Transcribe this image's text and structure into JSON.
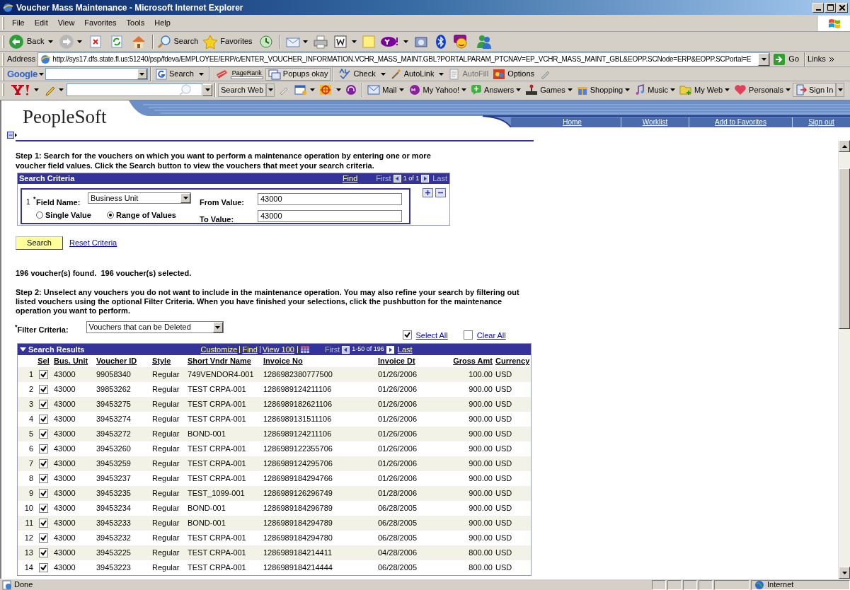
{
  "window": {
    "title": "Voucher Mass Maintenance - Microsoft Internet Explorer"
  },
  "menu": [
    "File",
    "Edit",
    "View",
    "Favorites",
    "Tools",
    "Help"
  ],
  "toolbar": {
    "back": "Back",
    "search": "Search",
    "favorites": "Favorites"
  },
  "address_bar": {
    "label": "Address",
    "url": "http://sys17.dfs.state.fl.us:51240/psp/fdeva/EMPLOYEE/ERP/c/ENTER_VOUCHER_INFORMATION.VCHR_MASS_MAINT.GBL?PORTALPARAM_PTCNAV=EP_VCHR_MASS_MAINT_GBL&EOPP.SCNode=ERP&EOPP.SCPortal=E",
    "go": "Go",
    "links": "Links"
  },
  "google_toolbar": {
    "logo": "Google",
    "pagerank": "PageRank",
    "items": [
      {
        "label": "Search",
        "disabled": false
      },
      {
        "label": "Popups okay",
        "disabled": false
      },
      {
        "label": "Check",
        "disabled": false
      },
      {
        "label": "AutoLink",
        "disabled": false
      },
      {
        "label": "AutoFill",
        "disabled": true
      },
      {
        "label": "Options",
        "disabled": false
      }
    ]
  },
  "yahoo_toolbar": {
    "search": "Search Web",
    "items": [
      "Mail",
      "My Yahoo!",
      "Answers",
      "Games",
      "Shopping",
      "Music",
      "My Web",
      "Personals"
    ],
    "sign_in": "Sign In"
  },
  "header": {
    "logo": "PeopleSoft",
    "nav": [
      "Home",
      "Worklist",
      "Add to Favorites",
      "Sign out"
    ]
  },
  "step1": "Step 1: Search for the vouchers on which you want to perform a maintenance operation by entering one or more voucher field values. Click the Search button to view the vouchers that meet your search criteria.",
  "search_criteria": {
    "title": "Search Criteria",
    "find": "Find",
    "first": "First",
    "count": "1 of 1",
    "last": "Last",
    "row_number": "1",
    "required_mark": "*",
    "field_label": "Field Name:",
    "field_value": "Business Unit",
    "from_label": "From Value:",
    "from_value": "43000",
    "to_label": "To Value:",
    "to_value": "43000",
    "options": [
      {
        "label": "Single Value",
        "selected": false
      },
      {
        "label": "Range of Values",
        "selected": true
      }
    ]
  },
  "search_button": "Search",
  "reset_link": "Reset Criteria",
  "found_text": "196 voucher(s) found.  196 voucher(s) selected.",
  "step2": "Step 2: Unselect any vouchers you do not want to include in the maintenance operation. You may also refine your search by filtering out listed vouchers using the optional Filter Criteria. When you have finished your selections, click the pushbutton for the maintenance operation you want to perform.",
  "filter": {
    "required_mark": "*",
    "label": "Filter Criteria:",
    "value": "Vouchers that can be Deleted"
  },
  "select_all": {
    "label": "Select All",
    "checked": true
  },
  "clear_all": {
    "label": "Clear All",
    "checked": false
  },
  "results": {
    "title": "Search Results",
    "links": [
      "Customize",
      "Find",
      "View 100"
    ],
    "first": "First",
    "range": "1-50 of 196",
    "last": "Last",
    "columns": [
      "Sel",
      "Bus. Unit",
      "Voucher ID",
      "Style",
      "Short Vndr Name",
      "Invoice No",
      "Invoice Dt",
      "Gross Amt",
      "Currency"
    ],
    "rows": [
      {
        "number": "1",
        "selected": true,
        "bus_unit": "43000",
        "voucher_id": "99058340",
        "style": "Regular",
        "vendor": "749VENDOR4-001",
        "invoice_no": "1286982380777500",
        "invoice_dt": "01/26/2006",
        "gross_amt": "100.00",
        "currency": "USD"
      },
      {
        "number": "2",
        "selected": true,
        "bus_unit": "43000",
        "voucher_id": "39853262",
        "style": "Regular",
        "vendor": "TEST CRPA-001",
        "invoice_no": "1286989124211106",
        "invoice_dt": "01/26/2006",
        "gross_amt": "900.00",
        "currency": "USD"
      },
      {
        "number": "3",
        "selected": true,
        "bus_unit": "43000",
        "voucher_id": "39453275",
        "style": "Regular",
        "vendor": "TEST CRPA-001",
        "invoice_no": "1286989182621106",
        "invoice_dt": "01/26/2006",
        "gross_amt": "900.00",
        "currency": "USD"
      },
      {
        "number": "4",
        "selected": true,
        "bus_unit": "43000",
        "voucher_id": "39453274",
        "style": "Regular",
        "vendor": "TEST CRPA-001",
        "invoice_no": "1286989131511106",
        "invoice_dt": "01/26/2006",
        "gross_amt": "900.00",
        "currency": "USD"
      },
      {
        "number": "5",
        "selected": true,
        "bus_unit": "43000",
        "voucher_id": "39453272",
        "style": "Regular",
        "vendor": "BOND-001",
        "invoice_no": "1286989124211106",
        "invoice_dt": "01/26/2006",
        "gross_amt": "900.00",
        "currency": "USD"
      },
      {
        "number": "6",
        "selected": true,
        "bus_unit": "43000",
        "voucher_id": "39453260",
        "style": "Regular",
        "vendor": "TEST CRPA-001",
        "invoice_no": "1286989122355706",
        "invoice_dt": "01/26/2006",
        "gross_amt": "900.00",
        "currency": "USD"
      },
      {
        "number": "7",
        "selected": true,
        "bus_unit": "43000",
        "voucher_id": "39453259",
        "style": "Regular",
        "vendor": "TEST CRPA-001",
        "invoice_no": "1286989124295706",
        "invoice_dt": "01/26/2006",
        "gross_amt": "900.00",
        "currency": "USD"
      },
      {
        "number": "8",
        "selected": true,
        "bus_unit": "43000",
        "voucher_id": "39453237",
        "style": "Regular",
        "vendor": "TEST CRPA-001",
        "invoice_no": "1286989184294766",
        "invoice_dt": "01/26/2006",
        "gross_amt": "900.00",
        "currency": "USD"
      },
      {
        "number": "9",
        "selected": true,
        "bus_unit": "43000",
        "voucher_id": "39453235",
        "style": "Regular",
        "vendor": "TEST_1099-001",
        "invoice_no": "1286989126296749",
        "invoice_dt": "01/28/2006",
        "gross_amt": "900.00",
        "currency": "USD"
      },
      {
        "number": "10",
        "selected": true,
        "bus_unit": "43000",
        "voucher_id": "39453234",
        "style": "Regular",
        "vendor": "BOND-001",
        "invoice_no": "1286989184296789",
        "invoice_dt": "06/28/2005",
        "gross_amt": "900.00",
        "currency": "USD"
      },
      {
        "number": "11",
        "selected": true,
        "bus_unit": "43000",
        "voucher_id": "39453233",
        "style": "Regular",
        "vendor": "BOND-001",
        "invoice_no": "1286989184294789",
        "invoice_dt": "06/28/2005",
        "gross_amt": "900.00",
        "currency": "USD"
      },
      {
        "number": "12",
        "selected": true,
        "bus_unit": "43000",
        "voucher_id": "39453232",
        "style": "Regular",
        "vendor": "TEST CRPA-001",
        "invoice_no": "1286989184294780",
        "invoice_dt": "06/28/2005",
        "gross_amt": "900.00",
        "currency": "USD"
      },
      {
        "number": "13",
        "selected": true,
        "bus_unit": "43000",
        "voucher_id": "39453225",
        "style": "Regular",
        "vendor": "TEST CRPA-001",
        "invoice_no": "1286989184214411",
        "invoice_dt": "04/28/2006",
        "gross_amt": "800.00",
        "currency": "USD"
      },
      {
        "number": "14",
        "selected": true,
        "bus_unit": "43000",
        "voucher_id": "39453223",
        "style": "Regular",
        "vendor": "TEST CRPA-001",
        "invoice_no": "1286989184214444",
        "invoice_dt": "06/28/2005",
        "gross_amt": "800.00",
        "currency": "USD"
      }
    ]
  },
  "status_bar": {
    "text": "Done",
    "zone": "Internet"
  }
}
